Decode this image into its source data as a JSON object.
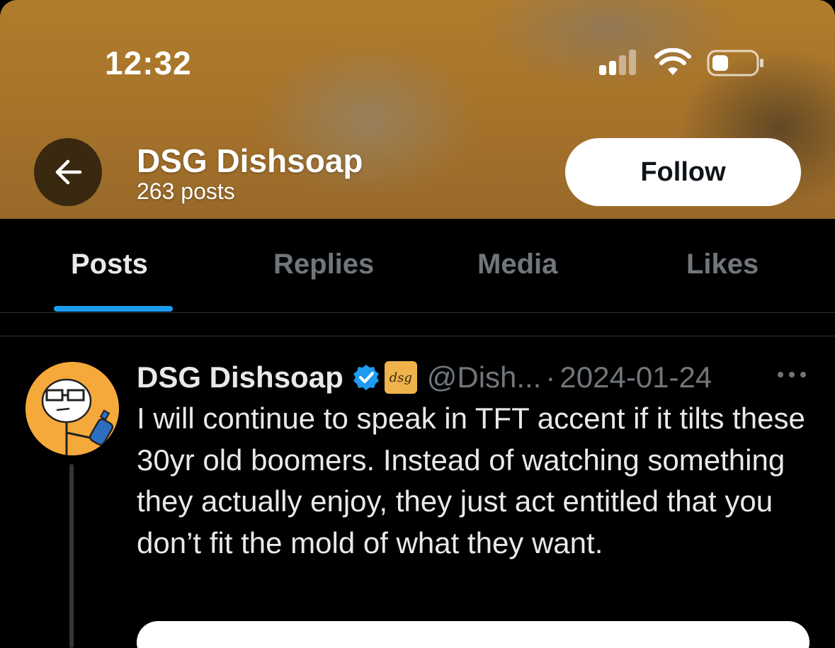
{
  "status_bar": {
    "time": "12:32"
  },
  "header": {
    "back_icon": "arrow-left-icon",
    "name": "DSG Dishsoap",
    "post_count": "263 posts",
    "follow_label": "Follow",
    "banner_color": "#a5722a"
  },
  "tabs": [
    {
      "label": "Posts",
      "active": true
    },
    {
      "label": "Replies",
      "active": false
    },
    {
      "label": "Media",
      "active": false
    },
    {
      "label": "Likes",
      "active": false
    }
  ],
  "accent_color": "#1d9bf0",
  "post": {
    "author_name": "DSG Dishsoap",
    "verified_icon": "verified-badge-icon",
    "affiliate_badge": "dsg",
    "handle": "@Dish...",
    "separator": "·",
    "date": "2024-01-24",
    "more_icon": "more-horizontal-icon",
    "text": "I will continue to speak in TFT accent if it tilts these 30yr old boomers. Instead of watching something they actually enjoy, they just act entitled that you don’t fit the mold of what they want."
  }
}
